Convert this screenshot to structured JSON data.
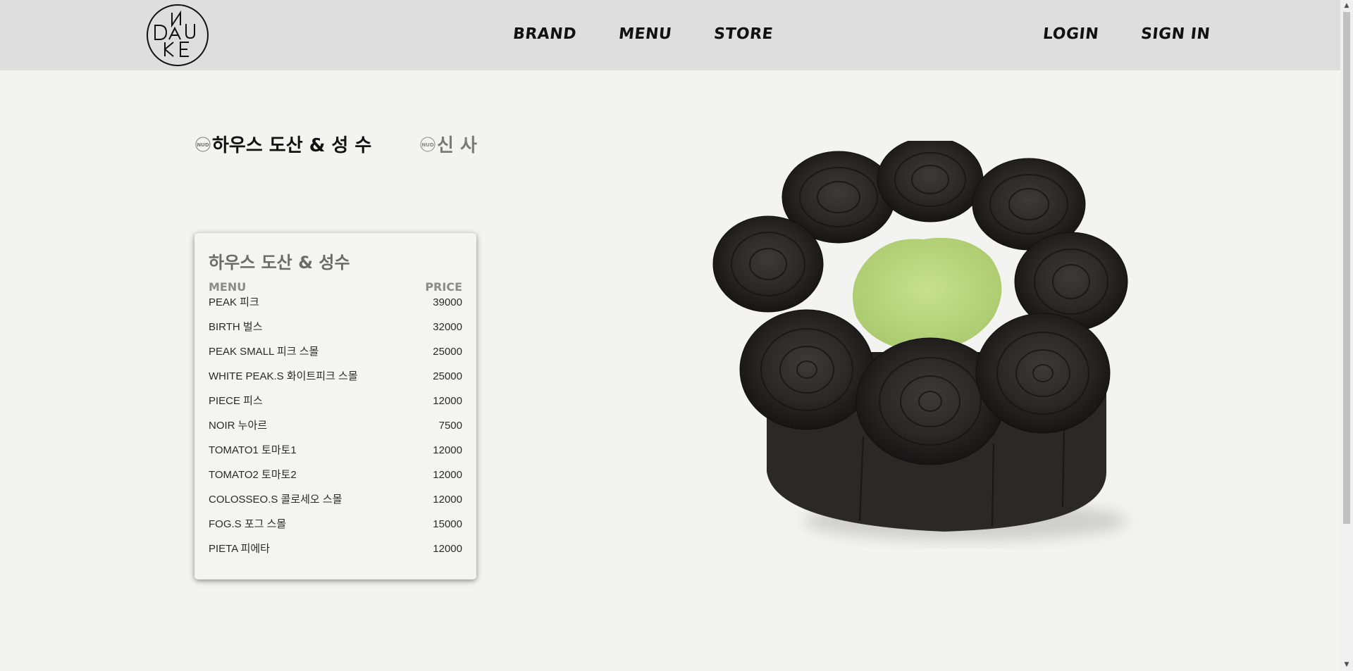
{
  "header": {
    "logo_letters": "NUDAKE",
    "nav_main": [
      "BRAND",
      "MENU",
      "STORE"
    ],
    "nav_auth": [
      "LOGIN",
      "SIGN IN"
    ]
  },
  "stores": {
    "tabs": [
      {
        "label": "하우스 도산 & 성 수",
        "active": true
      },
      {
        "label": "신 사",
        "active": false
      }
    ]
  },
  "menu_card": {
    "title": "하우스 도산 & 성수",
    "col_menu": "MENU",
    "col_price": "PRICE",
    "items": [
      {
        "name": "PEAK 피크",
        "price": "39000"
      },
      {
        "name": "BIRTH 벌스",
        "price": "32000"
      },
      {
        "name": "PEAK SMALL 피크 스몰",
        "price": "25000"
      },
      {
        "name": "WHITE PEAK.S 화이트피크 스몰",
        "price": "25000"
      },
      {
        "name": "PIECE 피스",
        "price": "12000"
      },
      {
        "name": "NOIR 누아르",
        "price": "7500"
      },
      {
        "name": "TOMATO1 토마토1",
        "price": "12000"
      },
      {
        "name": "TOMATO2 토마토2",
        "price": "12000"
      },
      {
        "name": "COLOSSEO.S 콜로세오 스몰",
        "price": "12000"
      },
      {
        "name": "FOG.S 포그 스몰",
        "price": "15000"
      },
      {
        "name": "PIETA 피에타",
        "price": "12000"
      }
    ]
  },
  "product_image": {
    "icon": "black-cake-with-green-cream-image",
    "colors": {
      "cake": "#2a2726",
      "cream": "#b9d77f"
    }
  },
  "colors": {
    "header_bg": "#dedede",
    "page_bg": "#f3f3f2",
    "active_tab": "#111111",
    "inactive_tab": "#7a7a7a"
  }
}
